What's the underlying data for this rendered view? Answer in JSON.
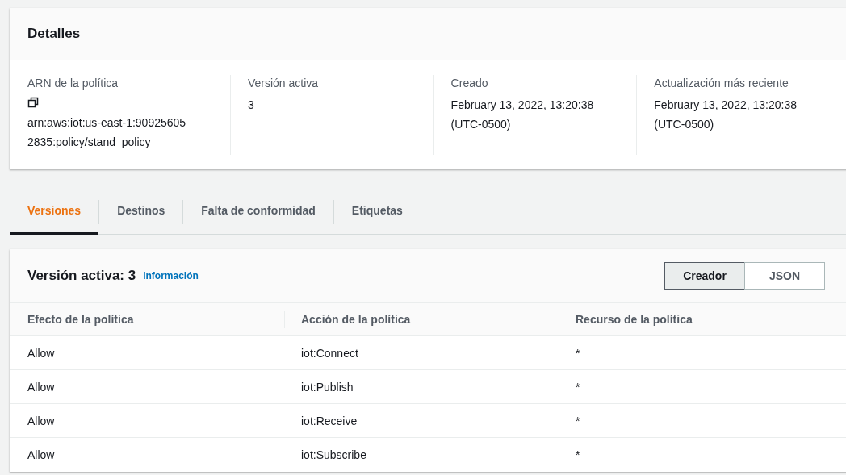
{
  "details": {
    "title": "Detalles",
    "fields": [
      {
        "label": "ARN de la política",
        "copyable": true,
        "value_lines": [
          "arn:aws:iot:us-east-1:90925605",
          "2835:policy/stand_policy"
        ]
      },
      {
        "label": "Versión activa",
        "copyable": false,
        "value_lines": [
          "3"
        ]
      },
      {
        "label": "Creado",
        "copyable": false,
        "value_lines": [
          "February 13, 2022, 13:20:38",
          "(UTC-0500)"
        ]
      },
      {
        "label": "Actualización más reciente",
        "copyable": false,
        "value_lines": [
          "February 13, 2022, 13:20:38",
          "(UTC-0500)"
        ]
      }
    ]
  },
  "tabs": [
    {
      "label": "Versiones",
      "selected": true
    },
    {
      "label": "Destinos",
      "selected": false
    },
    {
      "label": "Falta de conformidad",
      "selected": false
    },
    {
      "label": "Etiquetas",
      "selected": false
    }
  ],
  "version_panel": {
    "title": "Versión activa: 3",
    "info_link": "Información",
    "view_toggle": [
      {
        "label": "Creador",
        "selected": true
      },
      {
        "label": "JSON",
        "selected": false
      }
    ],
    "table": {
      "columns": [
        "Efecto de la política",
        "Acción de la política",
        "Recurso de la política"
      ],
      "rows": [
        [
          "Allow",
          "iot:Connect",
          "*"
        ],
        [
          "Allow",
          "iot:Publish",
          "*"
        ],
        [
          "Allow",
          "iot:Receive",
          "*"
        ],
        [
          "Allow",
          "iot:Subscribe",
          "*"
        ]
      ]
    }
  }
}
